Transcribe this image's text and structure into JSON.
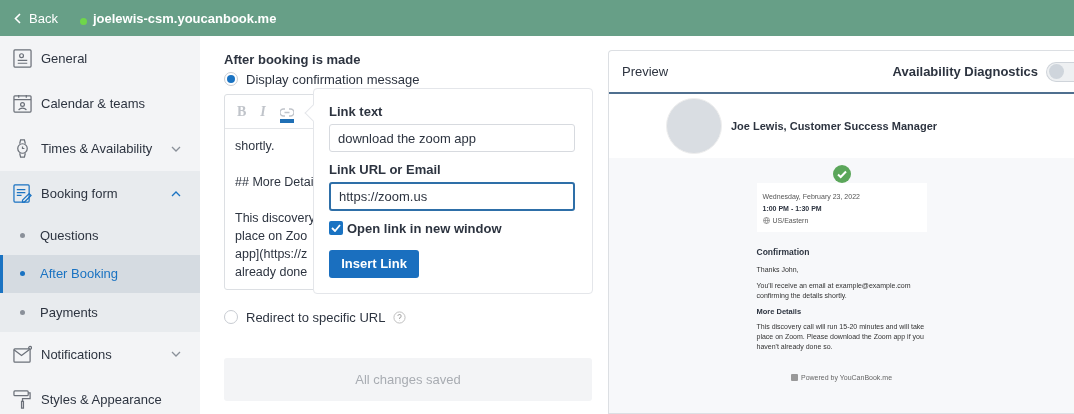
{
  "header": {
    "back_label": "Back",
    "site": "joelewis-csm.youcanbook.me",
    "online": true
  },
  "sidebar": {
    "items": [
      {
        "label": "General",
        "selected": false
      },
      {
        "label": "Calendar & teams",
        "selected": false
      },
      {
        "label": "Times & Availability",
        "selected": false,
        "expanded": false
      },
      {
        "label": "Booking form",
        "selected": true,
        "expanded": true,
        "children": [
          {
            "label": "Questions",
            "selected": false
          },
          {
            "label": "After Booking",
            "selected": true
          },
          {
            "label": "Payments",
            "selected": false
          }
        ]
      },
      {
        "label": "Notifications",
        "selected": false,
        "expanded": false
      },
      {
        "label": "Styles & Appearance",
        "selected": false
      }
    ]
  },
  "main": {
    "section_title": "After booking is made",
    "options": [
      {
        "label": "Display confirmation message",
        "selected": true
      },
      {
        "label": "Redirect to specific URL",
        "selected": false,
        "help": true
      }
    ],
    "editor": {
      "toolbar": [
        "B",
        "I"
      ],
      "link_active": true,
      "blocks": [
        [
          "shortly."
        ],
        [
          "## More Detai"
        ],
        [
          "This discovery",
          "place on Zoo",
          "app](https://z",
          "already done"
        ]
      ]
    },
    "link_popover": {
      "link_text_label": "Link text",
      "link_text_value": "download the zoom app",
      "url_label": "Link URL or Email",
      "url_value": "https://zoom.us",
      "new_window": {
        "label": "Open link in new window",
        "checked": true
      },
      "button": "Insert Link"
    },
    "save_button": {
      "label": "All changes saved",
      "disabled": true
    }
  },
  "preview": {
    "title": "Preview",
    "diagnostics": {
      "label": "Availability Diagnostics",
      "on": false
    },
    "host": "Joe Lewis, Customer Success Manager",
    "booking": {
      "date": "Wednesday, February 23, 2022",
      "time": "1:00 PM - 1:30 PM",
      "timezone": "US/Eastern"
    },
    "confirmation": {
      "heading": "Confirmation",
      "paragraphs": [
        "Thanks John,",
        "You'll receive an email at example@example.com confirming the details shortly."
      ],
      "subheading": "More Details",
      "details": "This discovery call will run 15-20 minutes and will take place on Zoom. Please download the Zoom app if you haven't already done so."
    },
    "powered_by": "Powered by YouCanBook.me"
  }
}
